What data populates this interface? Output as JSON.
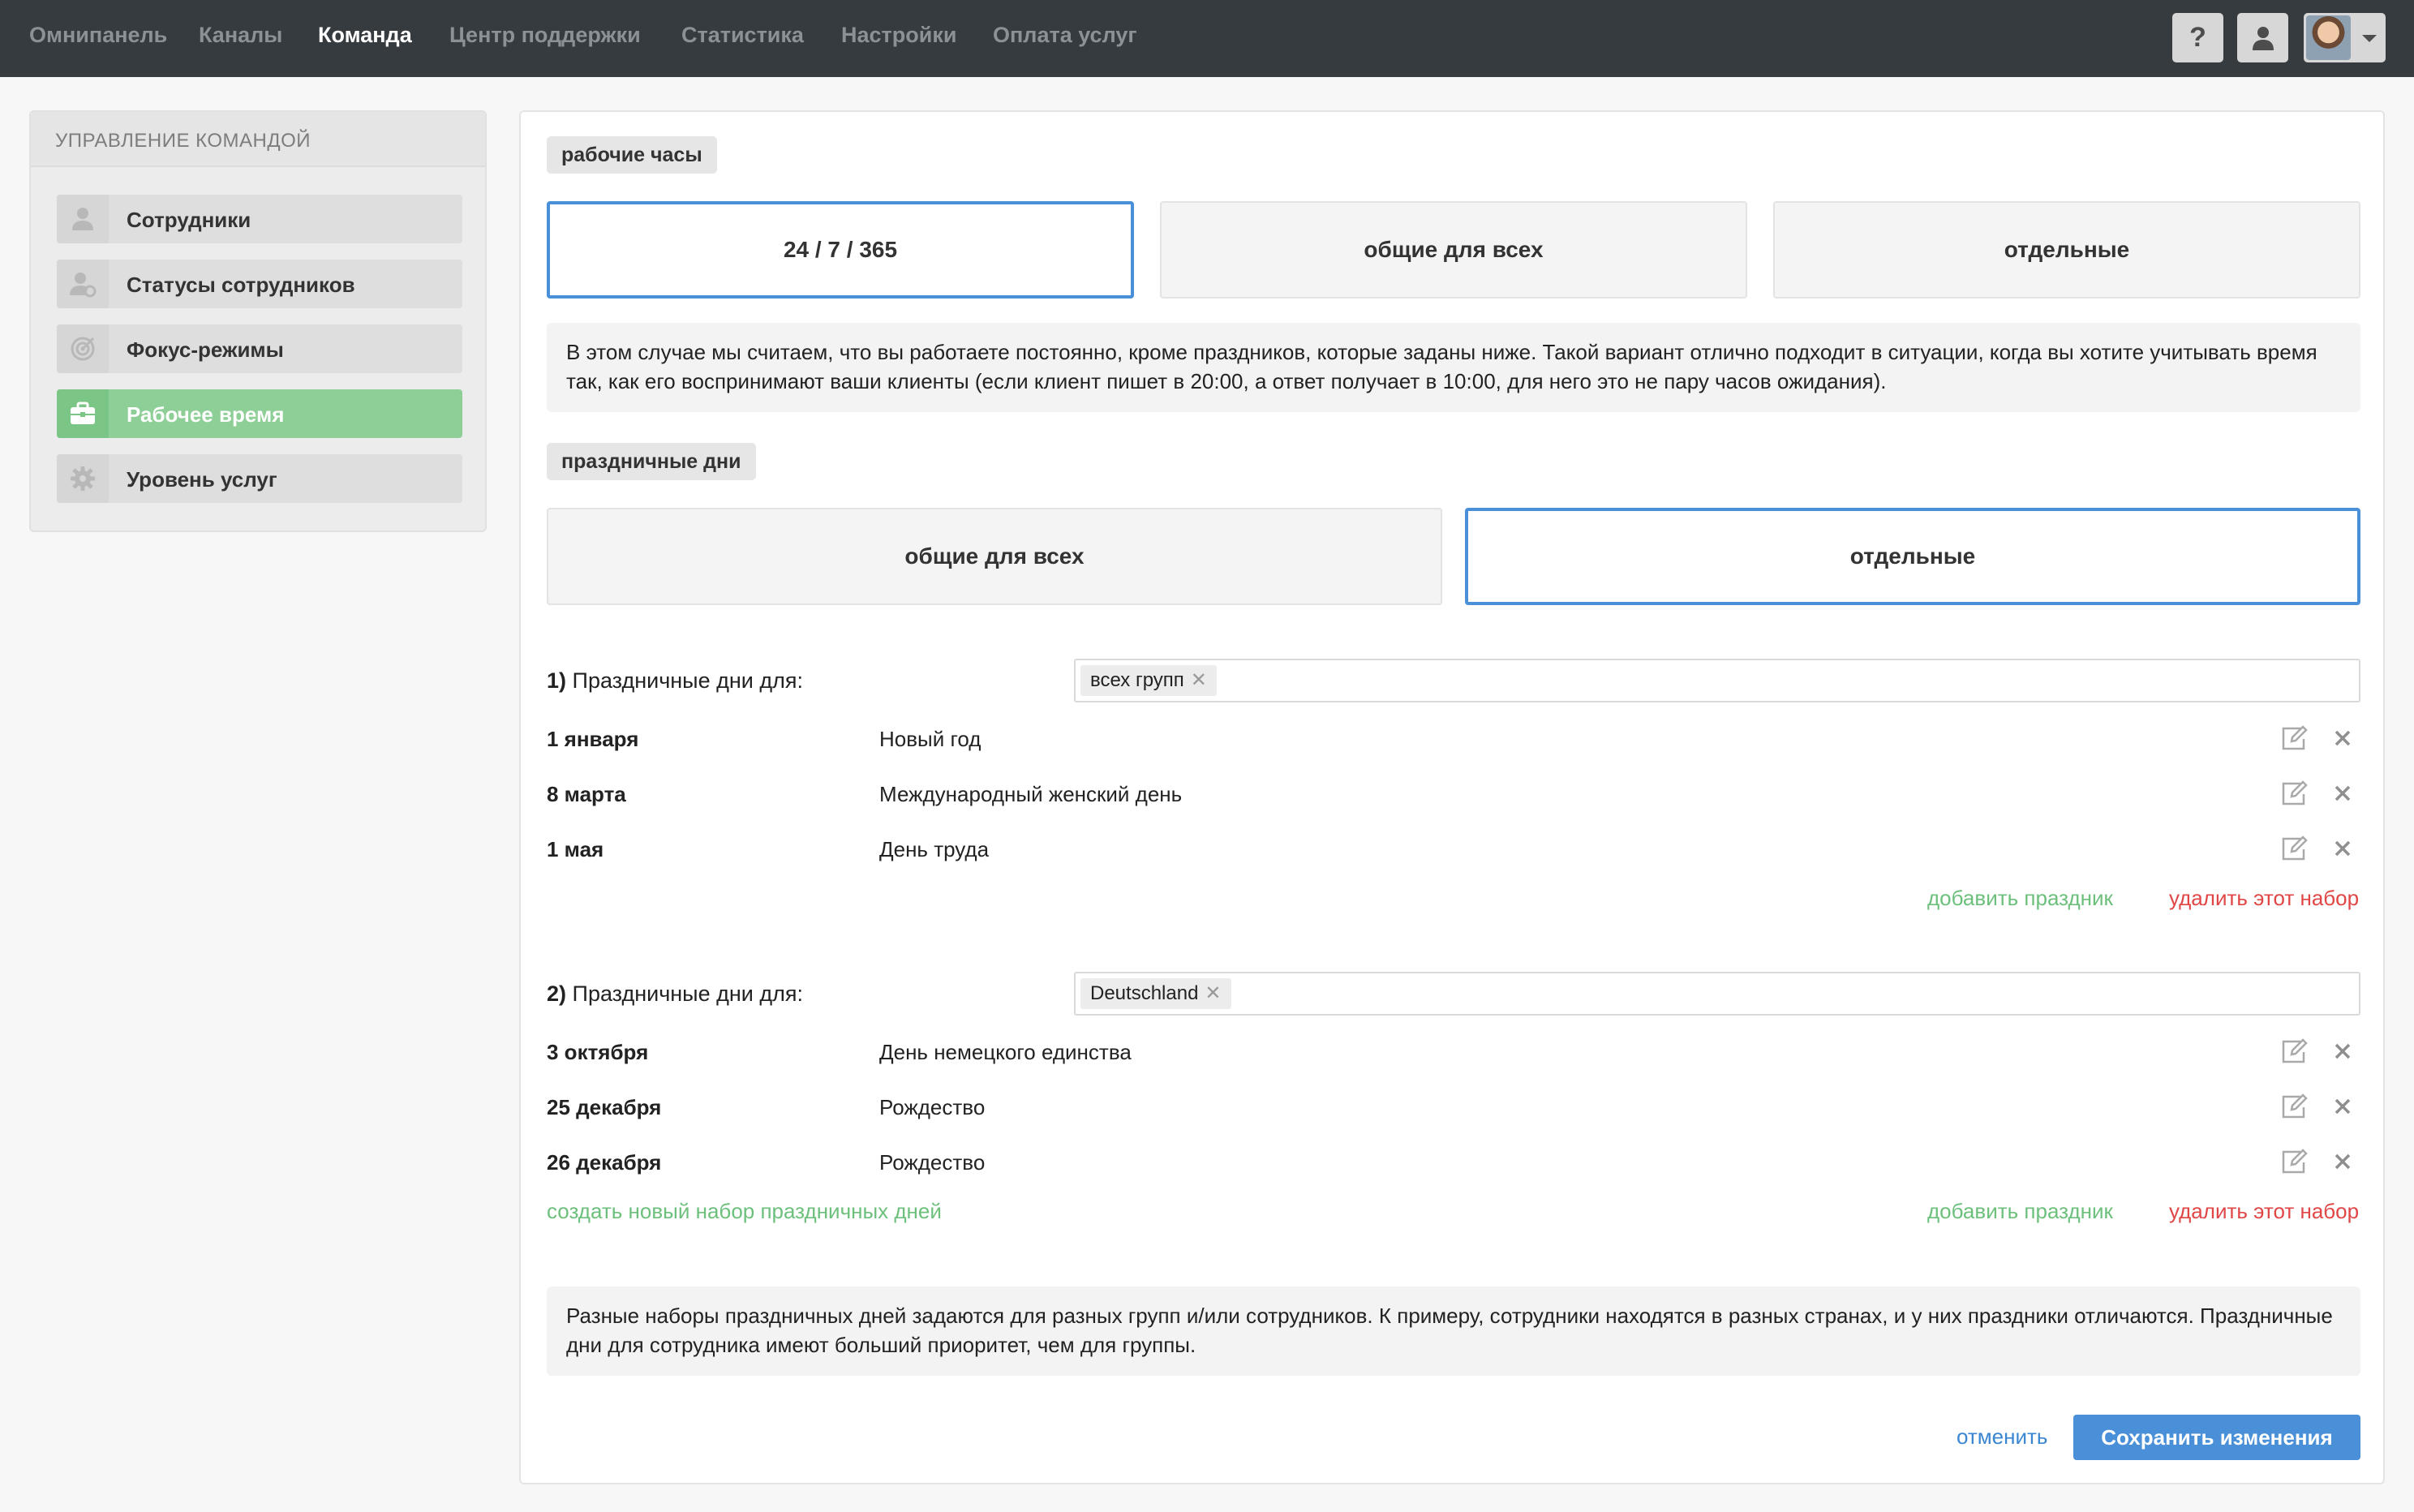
{
  "nav": {
    "items": [
      {
        "label": "Омнипанель",
        "active": false
      },
      {
        "label": "Каналы",
        "active": false
      },
      {
        "label": "Команда",
        "active": true
      },
      {
        "label": "Центр поддержки",
        "active": false
      },
      {
        "label": "Статистика",
        "active": false
      },
      {
        "label": "Настройки",
        "active": false
      },
      {
        "label": "Оплата услуг",
        "active": false
      }
    ],
    "help_label": "?",
    "icons": [
      "help-icon",
      "user-icon",
      "avatar",
      "chevron-down-icon"
    ]
  },
  "sidebar": {
    "title": "УПРАВЛЕНИЕ КОМАНДОЙ",
    "items": [
      {
        "label": "Сотрудники",
        "icon": "user-icon",
        "active": false
      },
      {
        "label": "Статусы сотрудников",
        "icon": "user-status-icon",
        "active": false
      },
      {
        "label": "Фокус-режимы",
        "icon": "target-icon",
        "active": false
      },
      {
        "label": "Рабочее время",
        "icon": "briefcase-icon",
        "active": true
      },
      {
        "label": "Уровень услуг",
        "icon": "gear-icon",
        "active": false
      }
    ]
  },
  "working_hours": {
    "label": "рабочие часы",
    "options": [
      {
        "label": "24 / 7 / 365",
        "selected": true
      },
      {
        "label": "общие для всех",
        "selected": false
      },
      {
        "label": "отдельные",
        "selected": false
      }
    ],
    "info_text": "В этом случае мы считаем, что вы работаете постоянно, кроме праздников, которые заданы ниже. Такой вариант отлично подходит в ситуации, когда вы хотите учитывать время так, как его воспринимают ваши клиенты (если клиент пишет в 20:00, а ответ получает в 10:00, для него это не пару часов ожидания)."
  },
  "holidays": {
    "label": "праздничные дни",
    "options": [
      {
        "label": "общие для всех",
        "selected": false
      },
      {
        "label": "отдельные",
        "selected": true
      }
    ],
    "sets": [
      {
        "number": "1)",
        "title": "Праздничные дни для:",
        "tag": "всех групп",
        "items": [
          {
            "date": "1 января",
            "name": "Новый год"
          },
          {
            "date": "8 марта",
            "name": "Международный женский день"
          },
          {
            "date": "1 мая",
            "name": "День труда"
          }
        ],
        "add_label": "добавить праздник",
        "delete_label": "удалить этот набор"
      },
      {
        "number": "2)",
        "title": "Праздничные дни для:",
        "tag": "Deutschland",
        "items": [
          {
            "date": "3 октября",
            "name": "День немецкого единства"
          },
          {
            "date": "25 декабря",
            "name": "Рождество"
          },
          {
            "date": "26 декабря",
            "name": "Рождество"
          }
        ],
        "add_label": "добавить праздник",
        "delete_label": "удалить этот набор"
      }
    ],
    "create_label": "создать новый набор праздничных дней",
    "info_text": "Разные наборы праздничных дней задаются для разных групп и/или сотрудников. К примеру, сотрудники находятся в разных странах, и у них праздники отличаются. Праздничные дни для сотрудника имеют больший приоритет, чем для группы."
  },
  "footer": {
    "cancel_label": "отменить",
    "save_label": "Сохранить изменения"
  },
  "colors": {
    "topbar": "#363b40",
    "accent_blue": "#4a90d9",
    "active_green": "#8ecf97",
    "link_green": "#6cc07c",
    "link_red": "#e04646"
  }
}
